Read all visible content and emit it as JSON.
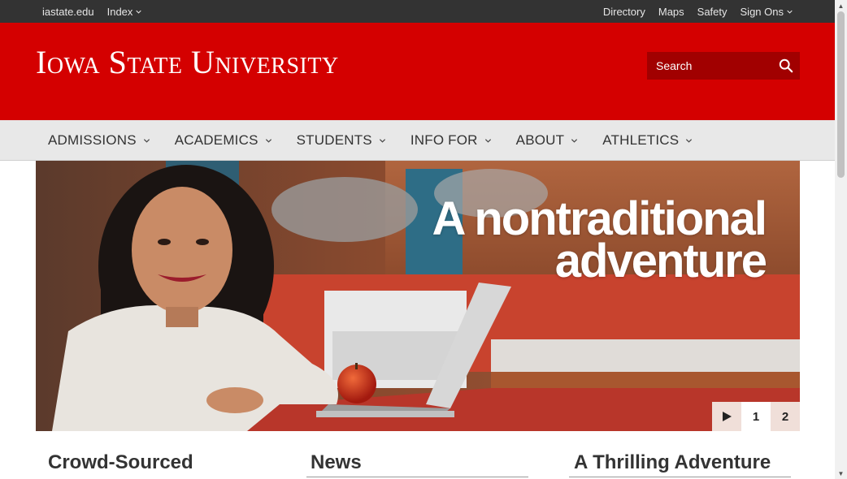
{
  "utility": {
    "left_links": [
      {
        "label": "iastate.edu",
        "dropdown": false
      },
      {
        "label": "Index",
        "dropdown": true
      }
    ],
    "right_links": [
      {
        "label": "Directory",
        "dropdown": false
      },
      {
        "label": "Maps",
        "dropdown": false
      },
      {
        "label": "Safety",
        "dropdown": false
      },
      {
        "label": "Sign Ons",
        "dropdown": true
      }
    ]
  },
  "header": {
    "logo_text": "Iowa State University",
    "search_placeholder": "Search"
  },
  "nav": {
    "items": [
      "ADMISSIONS",
      "ACADEMICS",
      "STUDENTS",
      "INFO FOR",
      "ABOUT",
      "ATHLETICS"
    ]
  },
  "hero": {
    "title_line1": "A nontraditional",
    "title_line2": "adventure",
    "slides": [
      "1",
      "2"
    ],
    "play_icon": "play-icon"
  },
  "columns": [
    {
      "title": "Crowd-Sourced"
    },
    {
      "title": "News"
    },
    {
      "title": "A Thrilling Adventure"
    }
  ],
  "colors": {
    "brand_red": "#d40000",
    "utility_bg": "#333333",
    "nav_bg": "#e8e8e8"
  }
}
